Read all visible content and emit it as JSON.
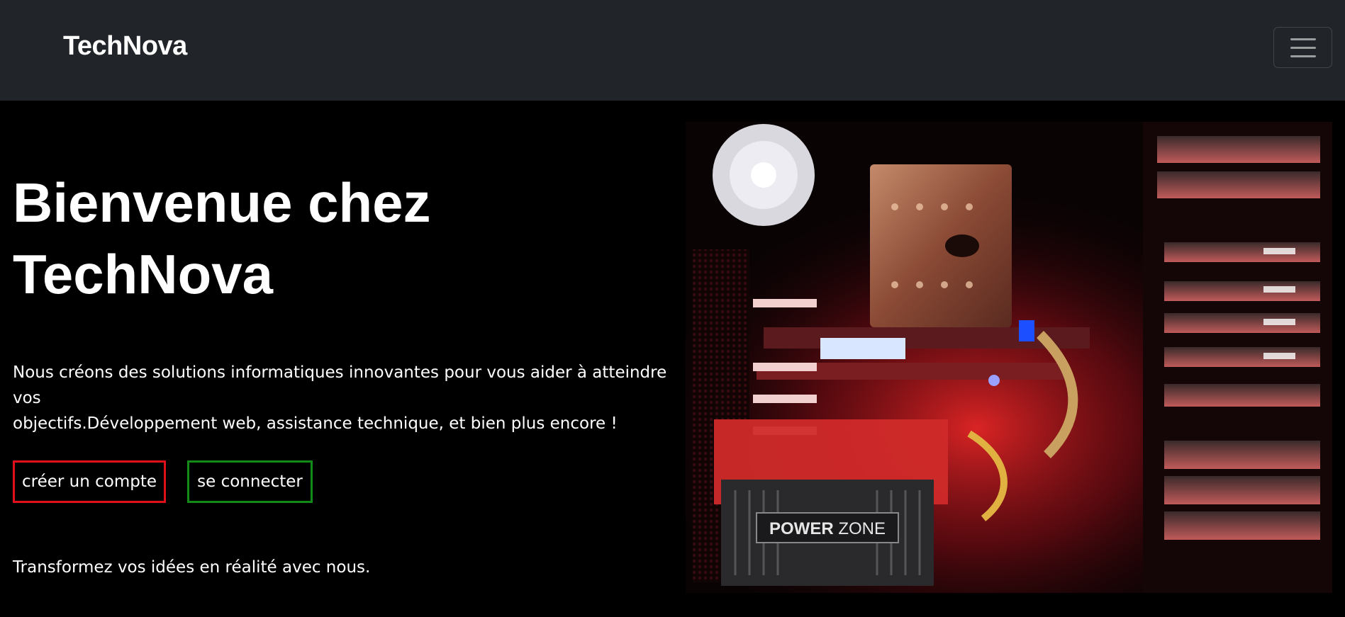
{
  "navbar": {
    "brand": "TechNova",
    "toggle_icon": "hamburger-menu-icon"
  },
  "hero": {
    "title_line1": "Bienvenue chez",
    "title_line2": "TechNova",
    "description_line1": "Nous créons des solutions informatiques innovantes pour vous aider à atteindre vos",
    "description_line2": "objectifs.Développement web, assistance technique, et bien plus encore !",
    "create_account_label": "créer un compte",
    "login_label": "se connecter",
    "tagline": "Transformez vos idées en réalité avec nous."
  },
  "image": {
    "psu_label_bold": "POWER",
    "psu_label_rest": " ZONE"
  },
  "colors": {
    "navbar_bg": "#212529",
    "page_bg": "#000000",
    "create_border": "#e0101a",
    "login_border": "#128a18"
  }
}
